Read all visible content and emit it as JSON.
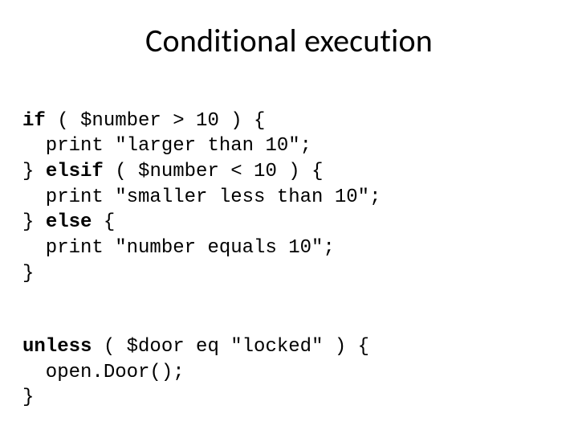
{
  "title": "Conditional execution",
  "code1": {
    "l0": {
      "kw": "if",
      "rest": " ( $number > 10 ) {"
    },
    "l1": "  print \"larger than 10\";",
    "l2": {
      "pre": "} ",
      "kw": "elsif",
      "rest": " ( $number < 10 ) {"
    },
    "l3": "  print \"smaller less than 10\";",
    "l4": {
      "pre": "} ",
      "kw": "else",
      "rest": " {"
    },
    "l5": "  print \"number equals 10\";",
    "l6": "}"
  },
  "code2": {
    "l0": {
      "kw": "unless",
      "rest": " ( $door eq \"locked\" ) {"
    },
    "l1": "  open.Door();",
    "l2": "}"
  }
}
